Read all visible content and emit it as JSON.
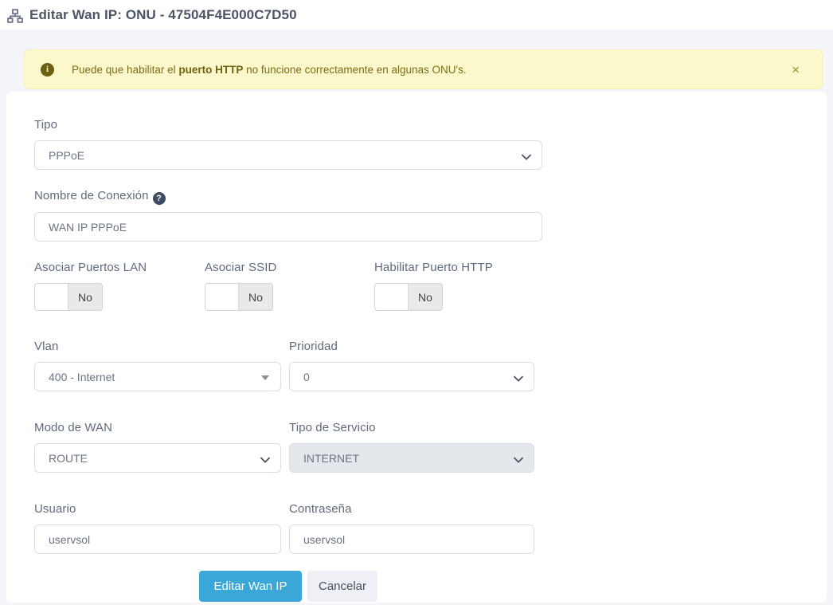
{
  "header": {
    "title": "Editar Wan IP: ONU - 47504F4E000C7D50"
  },
  "alert": {
    "text_prefix": "Puede que habilitar el ",
    "text_bold": "puerto HTTP",
    "text_suffix": " no funcione correctamente en algunas ONU's.",
    "close": "×"
  },
  "form": {
    "tipo": {
      "label": "Tipo",
      "value": "PPPoE"
    },
    "nombre": {
      "label": "Nombre de Conexión",
      "value": "WAN IP PPPoE"
    },
    "toggles": [
      {
        "label": "Asociar Puertos LAN",
        "state": "No"
      },
      {
        "label": "Asociar SSID",
        "state": "No"
      },
      {
        "label": "Habilitar Puerto HTTP",
        "state": "No"
      }
    ],
    "vlan": {
      "label": "Vlan",
      "value": "400 - Internet"
    },
    "prioridad": {
      "label": "Prioridad",
      "value": "0"
    },
    "modo_wan": {
      "label": "Modo de WAN",
      "value": "ROUTE"
    },
    "tipo_servicio": {
      "label": "Tipo de Servicio",
      "value": "INTERNET",
      "disabled": "true"
    },
    "usuario": {
      "label": "Usuario",
      "value": "uservsol"
    },
    "contrasena": {
      "label": "Contraseña",
      "value": "uservsol"
    },
    "help": {
      "symbol": "?"
    }
  },
  "actions": {
    "submit": "Editar Wan IP",
    "cancel": "Cancelar"
  },
  "colors": {
    "primary": "#3aa7d9",
    "alert_bg": "#fbf8cb",
    "alert_text": "#7a6d16",
    "page_bg": "#f4f4f9",
    "disabled_bg": "#e4e7ec"
  }
}
